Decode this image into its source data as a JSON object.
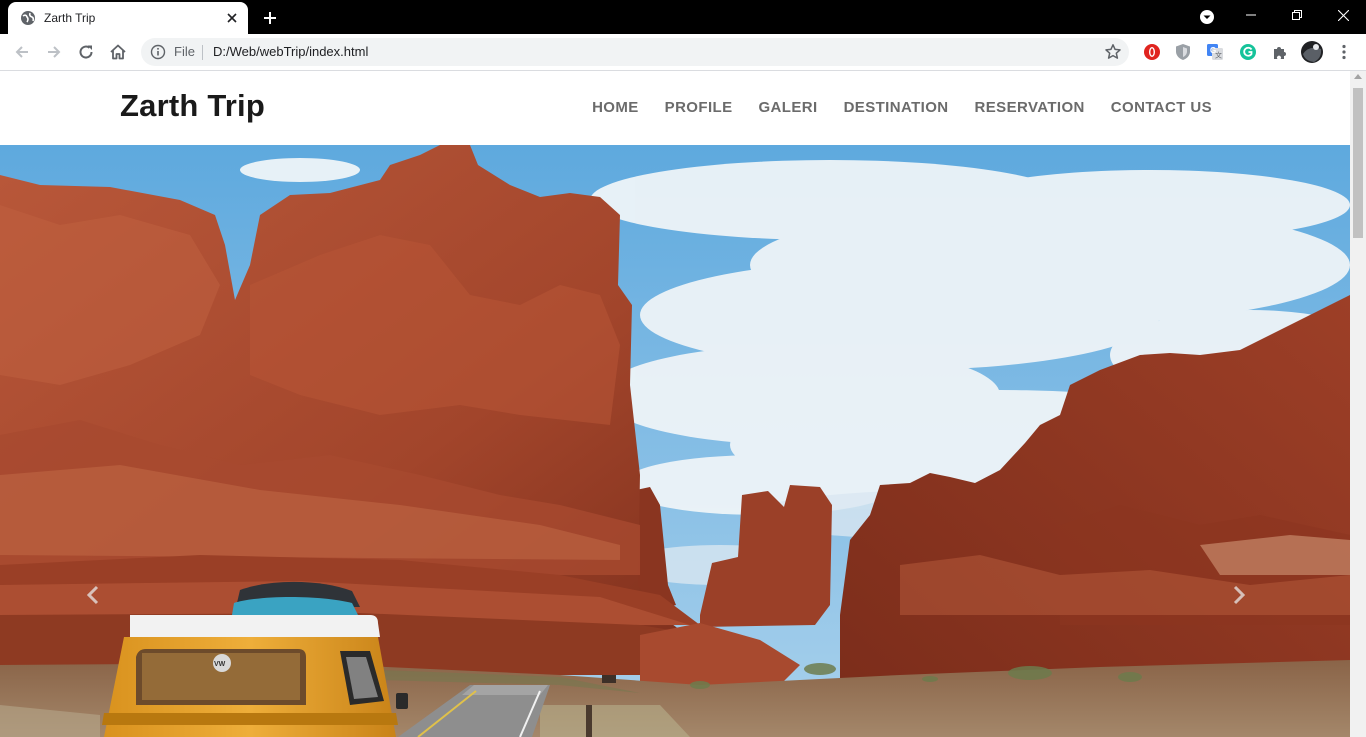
{
  "browser": {
    "tab_title": "Zarth Trip",
    "url_scheme": "File",
    "url": "D:/Web/webTrip/index.html"
  },
  "site": {
    "brand": "Zarth Trip",
    "menu": [
      "HOME",
      "PROFILE",
      "GALERI",
      "DESTINATION",
      "RESERVATION",
      "CONTACT US"
    ]
  },
  "hero": {
    "van_plate": "VW"
  },
  "icons": {
    "favicon": "globe-icon",
    "close": "close-icon",
    "new_tab": "plus-icon",
    "back": "back-arrow-icon",
    "forward": "forward-arrow-icon",
    "reload": "reload-icon",
    "home": "home-icon",
    "info": "info-icon",
    "bookmark": "star-icon",
    "extensions": [
      "opera-icon",
      "shield-icon",
      "translate-icon",
      "grammarly-icon",
      "puzzle-icon",
      "profile-avatar-icon"
    ],
    "menu": "kebab-menu-icon"
  },
  "colors": {
    "tab_strip": "#000000",
    "omnibox": "#f1f3f4",
    "nav_text": "#6b6b6b",
    "brand_text": "#1a1a1a",
    "sky": "#6cb2e0",
    "rock": "#a8472d",
    "van": "#e3a12d"
  }
}
